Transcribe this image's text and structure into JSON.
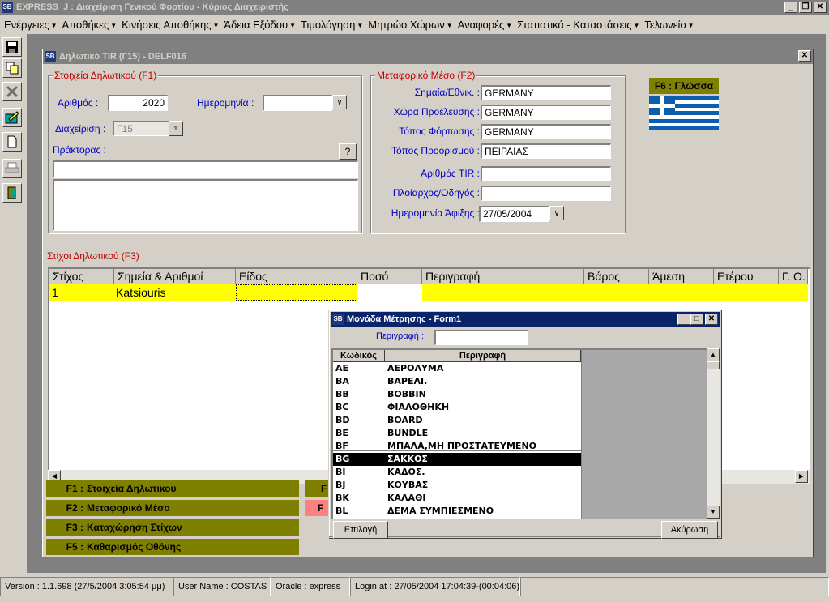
{
  "app": {
    "title": "EXPRESS_J : Διαχείριση Γενικού Φορτίου - Κύριος Διαχειριστής",
    "minimize": "_",
    "restore": "❐",
    "close": "✕"
  },
  "menu": [
    {
      "label": "Ενέργειες"
    },
    {
      "label": "Αποθήκες"
    },
    {
      "label": "Κινήσεις Αποθήκης"
    },
    {
      "label": "Άδεια Εξόδου"
    },
    {
      "label": "Τιμολόγηση"
    },
    {
      "label": "Μητρώο Χώρων"
    },
    {
      "label": "Αναφορές"
    },
    {
      "label": "Στατιστικά - Καταστάσεις"
    },
    {
      "label": "Τελωνείο"
    }
  ],
  "toolbar": {
    "icons": [
      "save-icon",
      "copy-icon",
      "delete-icon",
      "edit-icon",
      "new-document-icon",
      "print-icon",
      "exit-door-icon"
    ]
  },
  "child": {
    "title": "Δηλωτικό TIR (Γ15) - DELF016",
    "close": "✕"
  },
  "declaration": {
    "legend": "Στοιχεία Δηλωτικού (F1)",
    "number_label": "Αριθμός :",
    "number_value": "2020",
    "date_label": "Ημερομηνία :",
    "date_value": "",
    "management_label": "Διαχείριση :",
    "management_value": "Γ15",
    "agent_label": "Πράκτορας :",
    "agent_button": "?",
    "agent_value": "",
    "agent_notes": ""
  },
  "transport": {
    "legend": "Μεταφορικό Μέσο (F2)",
    "flag_label": "Σημαία/Εθνικ. :",
    "flag_value": "GERMANY",
    "origin_label": "Χώρα Προέλευσης :",
    "origin_value": "GERMANY",
    "loading_label": "Τόπος Φόρτωσης :",
    "loading_value": "GERMANY",
    "destination_label": "Τόπος Προορισμού :",
    "destination_value": "ΠΕΙΡΑΙΑΣ",
    "tir_label": "Αριθμός TIR :",
    "tir_value": "",
    "captain_label": "Πλοίαρχος/Οδηγός :",
    "captain_value": "",
    "arrival_label": "Ημερομηνία Άφιξης :",
    "arrival_value": "27/05/2004"
  },
  "language": {
    "label": "F6 : Γλώσσα"
  },
  "lines": {
    "legend": "Στίχοι Δηλωτικού (F3)",
    "columns": [
      "Στίχος",
      "Σημεία & Αριθμοί",
      "Είδος",
      "Ποσό",
      "Περιγραφή",
      "Βάρος",
      "Άμεση",
      "Ετέρου",
      "Γ. Ο."
    ],
    "rows": [
      {
        "line": "1",
        "marks": "Katsiouris",
        "kind": "",
        "amount": "",
        "description": ""
      }
    ]
  },
  "fkeys": [
    {
      "key": "F1 :",
      "label": "Στοιχεία Δηλωτικού"
    },
    {
      "key": "F2 :",
      "label": "Μεταφορικό Μέσο"
    },
    {
      "key": "F3 :",
      "label": "Καταχώρηση Στίχων"
    },
    {
      "key": "F5 :",
      "label": "Καθαρισμός Οθόνης"
    }
  ],
  "fkeys_hidden": {
    "a": "F",
    "b": "F"
  },
  "modal": {
    "title": "Μονάδα Μέτρησης - Form1",
    "search_label": "Περιγραφή :",
    "search_value": "",
    "col_code": "Κωδικός",
    "col_desc": "Περιγραφή",
    "items": [
      {
        "code": "AE",
        "desc": "ΑΕΡΟΛΥΜΑ"
      },
      {
        "code": "BA",
        "desc": "ΒΑΡΕΛΙ."
      },
      {
        "code": "BB",
        "desc": "BOBBIN"
      },
      {
        "code": "BC",
        "desc": "ΦΙΑΛΟΘΗΚΗ"
      },
      {
        "code": "BD",
        "desc": "BOARD"
      },
      {
        "code": "BE",
        "desc": "BUNDLE"
      },
      {
        "code": "BF",
        "desc": "ΜΠΑΛΑ,ΜΗ ΠΡΟΣΤΑΤΕΥΜΕΝΟ"
      },
      {
        "code": "BG",
        "desc": "ΣΑΚΚΟΣ"
      },
      {
        "code": "BI",
        "desc": "ΚΑΔΟΣ."
      },
      {
        "code": "BJ",
        "desc": "ΚΟΥΒΑΣ"
      },
      {
        "code": "BK",
        "desc": "ΚΑΛΑΘΙ"
      },
      {
        "code": "BL",
        "desc": "ΔΕΜΑ ΣΥΜΠΙΕΣΜΕΝΟ"
      }
    ],
    "selected_code": "BG",
    "select_button": "Επιλογή",
    "cancel_button": "Ακύρωση"
  },
  "status": {
    "version": "Version : 1.1.698 (27/5/2004 3:05:54 μμ)",
    "user": "User Name : COSTAS",
    "oracle": "Oracle : express",
    "login": "Login at : 27/05/2004 17:04:39-(00:04:06)"
  },
  "colors": {
    "selected_row": "#ffff00",
    "fkey_bg": "#808000",
    "legend_red": "#c00000",
    "label_blue": "#0000c0"
  }
}
